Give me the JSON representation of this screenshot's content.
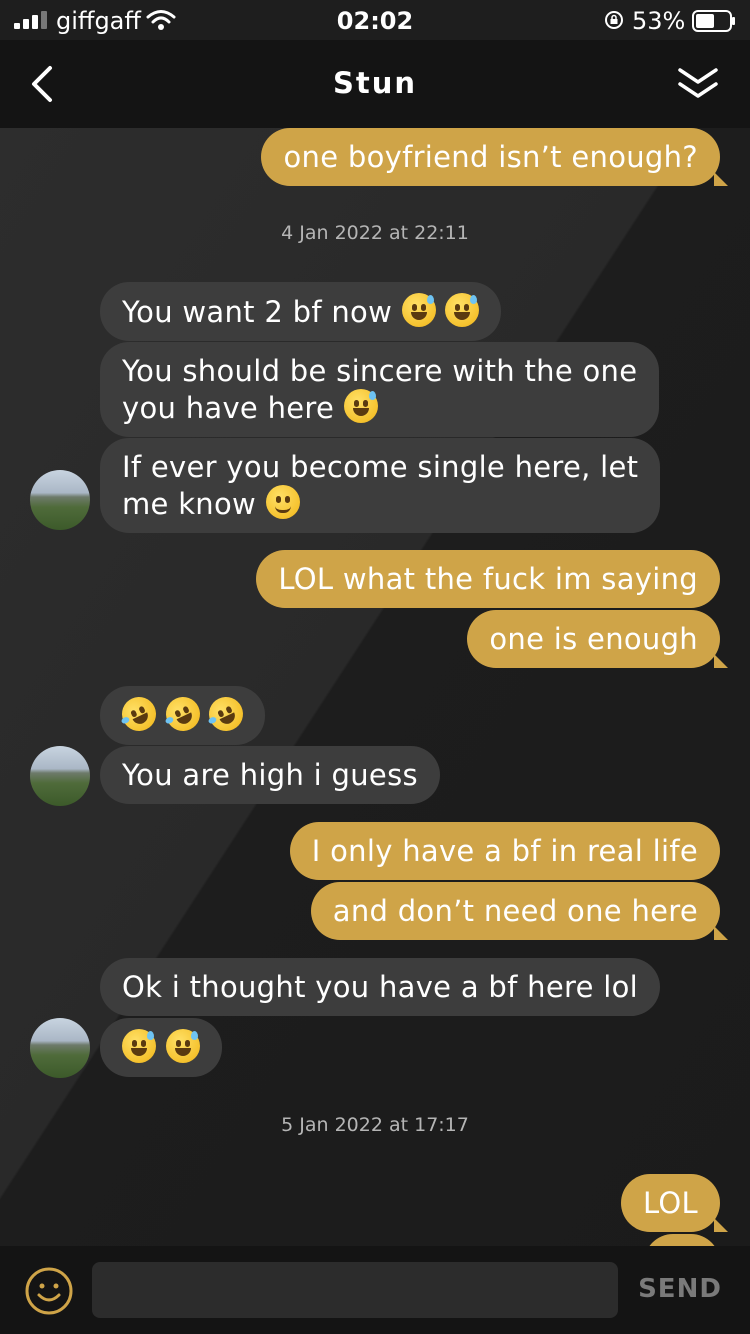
{
  "status_bar": {
    "carrier": "giffgaff",
    "time": "02:02",
    "battery_percent": "53%"
  },
  "header": {
    "title": "Stun",
    "back_icon": "chevron-left-icon",
    "collapse_icon": "double-chevron-down-icon"
  },
  "messages": {
    "m1": "one boyfriend isn’t enough?",
    "ts1": "4 Jan 2022 at 22:11",
    "m2": "You want 2 bf now",
    "m3_line1": "You should be sincere with the one",
    "m3_line2": "you have here",
    "m4_line1": "If ever you become single here, let",
    "m4_line2": "me know",
    "m5": "LOL what the fuck im saying",
    "m6": "one is enough",
    "m8": "You are high i guess",
    "m9": "I only have a bf in real life",
    "m10": "and don’t need one here",
    "m11": "Ok i thought you have a bf here lol",
    "ts2": "5 Jan 2022 at 17:17",
    "m13": "LOL"
  },
  "input_bar": {
    "placeholder": "",
    "send_label": "SEND",
    "emoji_icon": "smiley-icon"
  },
  "colors": {
    "outgoing_bubble": "#cfa448",
    "incoming_bubble": "#3d3d3d",
    "header_bg": "#141414",
    "chat_bg": "#2d2d2d"
  }
}
